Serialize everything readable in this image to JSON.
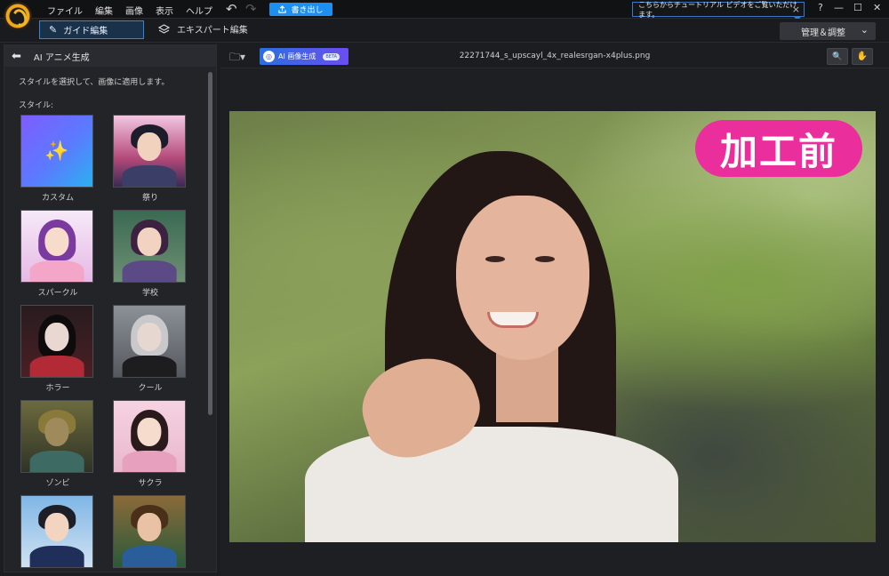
{
  "menu": [
    "ファイル",
    "編集",
    "画像",
    "表示",
    "ヘルプ"
  ],
  "toolbar": {
    "undo_icon": "↶",
    "redo_icon": "↷",
    "export_label": "書き出し"
  },
  "notification": {
    "text": "こちらからチュートリアル ビデオをご覧いただけます。",
    "close": "×"
  },
  "window_controls": {
    "help": "?",
    "minimize": "—",
    "maximize": "☐",
    "close": "✕"
  },
  "modes": {
    "guide": "ガイド編集",
    "expert": "エキスパート編集"
  },
  "manage": {
    "label": "管理＆調整",
    "chevron": "⌄"
  },
  "panel": {
    "back_icon": "⬅",
    "title": "AI アニメ生成",
    "description": "スタイルを選択して、画像に適用します。",
    "style_label": "スタイル:",
    "styles": [
      {
        "label": "カスタム"
      },
      {
        "label": "祭り"
      },
      {
        "label": "スパークル"
      },
      {
        "label": "学校"
      },
      {
        "label": "ホラー"
      },
      {
        "label": "クール"
      },
      {
        "label": "ゾンビ"
      },
      {
        "label": "サクラ"
      },
      {
        "label": ""
      },
      {
        "label": ""
      }
    ]
  },
  "editor": {
    "ai_label": "AI 画像生成",
    "beta": "BETA",
    "filename": "22271744_s_upscayl_4x_realesrgan-x4plus.png",
    "zoom_icon": "🔍",
    "hand_icon": "✋",
    "badge": "加工前"
  },
  "colors": {
    "accent": "#1d8ff0",
    "badge": "#ea2e9c"
  }
}
